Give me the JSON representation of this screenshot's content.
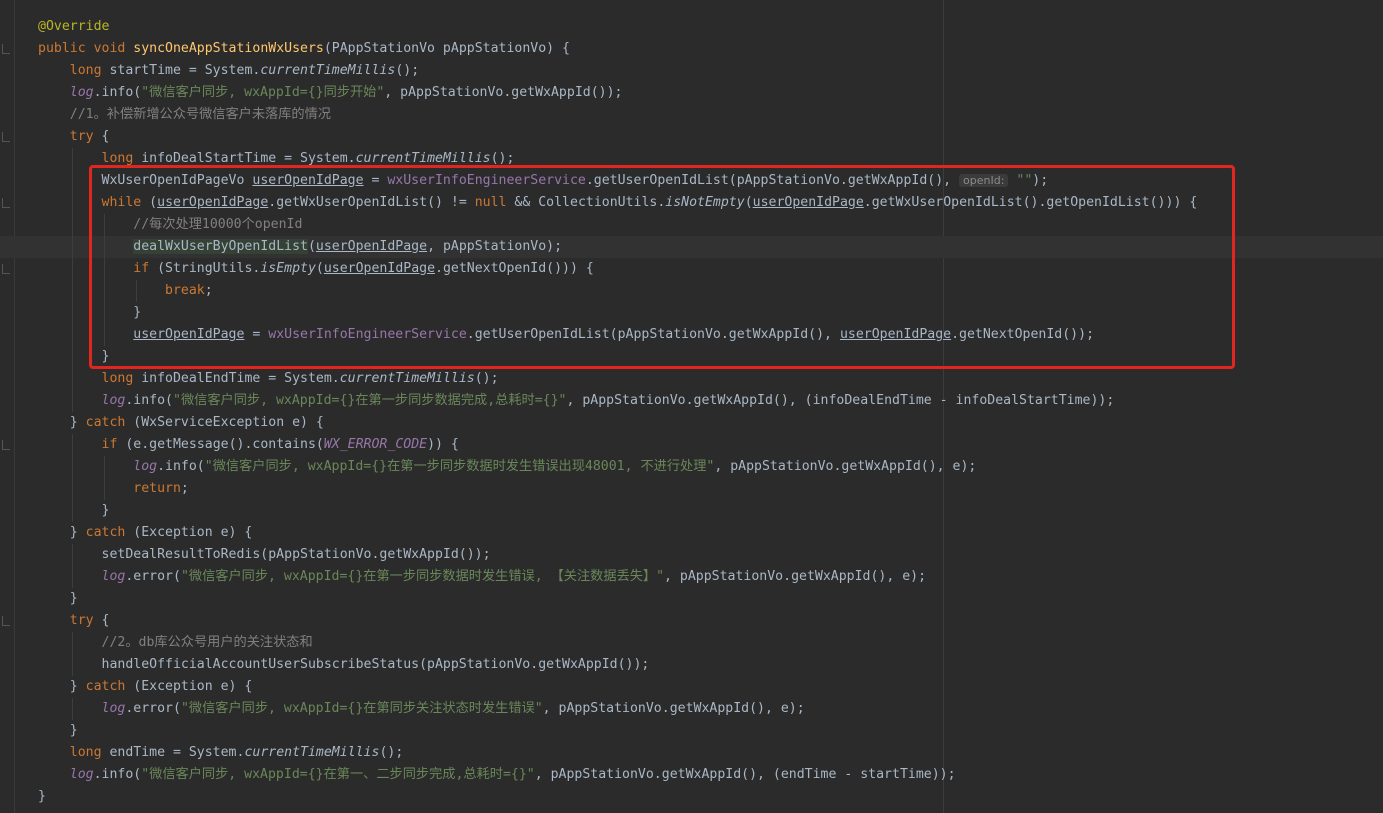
{
  "editor": {
    "lines": [
      [
        [
          "ann",
          "@Override"
        ]
      ],
      [
        [
          "kw",
          "public void "
        ],
        [
          "fn",
          "syncOneAppStationWxUsers"
        ],
        [
          "",
          "(PAppStationVo pAppStationVo) {"
        ]
      ],
      [
        [
          "",
          "    "
        ],
        [
          "kw",
          "long "
        ],
        [
          "",
          "startTime = System."
        ],
        [
          "it",
          "currentTimeMillis"
        ],
        [
          "",
          "();"
        ]
      ],
      [
        [
          "",
          "    "
        ],
        [
          "fieldi",
          "log"
        ],
        [
          "",
          ".info("
        ],
        [
          "str",
          "\"微信客户同步, wxAppId={}同步开始\""
        ],
        [
          "",
          ", pAppStationVo.getWxAppId());"
        ]
      ],
      [
        [
          "",
          "    "
        ],
        [
          "cmt",
          "//1。补偿新增公众号微信客户未落库的情况"
        ]
      ],
      [
        [
          "",
          "    "
        ],
        [
          "kw",
          "try "
        ],
        [
          "",
          "{"
        ]
      ],
      [
        [
          "",
          "        "
        ],
        [
          "kw",
          "long "
        ],
        [
          "",
          "infoDealStartTime = System."
        ],
        [
          "it",
          "currentTimeMillis"
        ],
        [
          "",
          "();"
        ]
      ],
      [
        [
          "",
          "        WxUserOpenIdPageVo "
        ],
        [
          "ul",
          "userOpenIdPage"
        ],
        [
          "",
          " = "
        ],
        [
          "field",
          "wxUserInfoEngineerService"
        ],
        [
          "",
          ".getUserOpenIdList(pAppStationVo.getWxAppId(), "
        ],
        [
          "hint",
          "openId:"
        ],
        [
          "",
          " "
        ],
        [
          "str",
          "\"\""
        ],
        [
          "",
          ");"
        ]
      ],
      [
        [
          "",
          "        "
        ],
        [
          "kw",
          "while "
        ],
        [
          "",
          "("
        ],
        [
          "ul",
          "userOpenIdPage"
        ],
        [
          "",
          ".getWxUserOpenIdList() != "
        ],
        [
          "kw",
          "null "
        ],
        [
          "",
          "&& CollectionUtils."
        ],
        [
          "it",
          "isNotEmpty"
        ],
        [
          "",
          "("
        ],
        [
          "ul",
          "userOpenIdPage"
        ],
        [
          "",
          ".getWxUserOpenIdList().getOpenIdList())) {"
        ]
      ],
      [
        [
          "",
          "            "
        ],
        [
          "cmt",
          "//每次处理10000个openId"
        ]
      ],
      [
        [
          "",
          "            "
        ],
        [
          "hl",
          "dealWxUserByOpenIdList"
        ],
        [
          "",
          "("
        ],
        [
          "ul",
          "userOpenIdPage"
        ],
        [
          "",
          ", pAppStationVo);"
        ]
      ],
      [
        [
          "",
          "            "
        ],
        [
          "kw",
          "if "
        ],
        [
          "",
          "(StringUtils."
        ],
        [
          "it",
          "isEmpty"
        ],
        [
          "",
          "("
        ],
        [
          "ul",
          "userOpenIdPage"
        ],
        [
          "",
          ".getNextOpenId())) {"
        ]
      ],
      [
        [
          "",
          "                "
        ],
        [
          "kw",
          "break"
        ],
        [
          "",
          ";"
        ]
      ],
      [
        [
          "",
          "            }"
        ]
      ],
      [
        [
          "",
          "            "
        ],
        [
          "ul",
          "userOpenIdPage"
        ],
        [
          "",
          " = "
        ],
        [
          "field",
          "wxUserInfoEngineerService"
        ],
        [
          "",
          ".getUserOpenIdList(pAppStationVo.getWxAppId(), "
        ],
        [
          "ul",
          "userOpenIdPage"
        ],
        [
          "",
          ".getNextOpenId());"
        ]
      ],
      [
        [
          "",
          "        }"
        ]
      ],
      [
        [
          "",
          "        "
        ],
        [
          "kw",
          "long "
        ],
        [
          "",
          "infoDealEndTime = System."
        ],
        [
          "it",
          "currentTimeMillis"
        ],
        [
          "",
          "();"
        ]
      ],
      [
        [
          "",
          "        "
        ],
        [
          "fieldi",
          "log"
        ],
        [
          "",
          ".info("
        ],
        [
          "str",
          "\"微信客户同步, wxAppId={}在第一步同步数据完成,总耗时={}\""
        ],
        [
          "",
          ", pAppStationVo.getWxAppId(), (infoDealEndTime - infoDealStartTime));"
        ]
      ],
      [
        [
          "",
          "    } "
        ],
        [
          "kw",
          "catch "
        ],
        [
          "",
          "(WxServiceException e) {"
        ]
      ],
      [
        [
          "",
          "        "
        ],
        [
          "kw",
          "if "
        ],
        [
          "",
          "(e.getMessage().contains("
        ],
        [
          "fieldi",
          "WX_ERROR_CODE"
        ],
        [
          "",
          ")) {"
        ]
      ],
      [
        [
          "",
          "            "
        ],
        [
          "fieldi",
          "log"
        ],
        [
          "",
          ".info("
        ],
        [
          "str",
          "\"微信客户同步, wxAppId={}在第一步同步数据时发生错误出现48001, 不进行处理\""
        ],
        [
          "",
          ", pAppStationVo.getWxAppId(), e);"
        ]
      ],
      [
        [
          "",
          "            "
        ],
        [
          "kw",
          "return"
        ],
        [
          "",
          ";"
        ]
      ],
      [
        [
          "",
          "        }"
        ]
      ],
      [
        [
          "",
          "    } "
        ],
        [
          "kw",
          "catch "
        ],
        [
          "",
          "(Exception e) {"
        ]
      ],
      [
        [
          "",
          "        setDealResultToRedis(pAppStationVo.getWxAppId());"
        ]
      ],
      [
        [
          "",
          "        "
        ],
        [
          "fieldi",
          "log"
        ],
        [
          "",
          ".error("
        ],
        [
          "str",
          "\"微信客户同步, wxAppId={}在第一步同步数据时发生错误, 【关注数据丢失】\""
        ],
        [
          "",
          ", pAppStationVo.getWxAppId(), e);"
        ]
      ],
      [
        [
          "",
          "    }"
        ]
      ],
      [
        [
          "",
          "    "
        ],
        [
          "kw",
          "try "
        ],
        [
          "",
          "{"
        ]
      ],
      [
        [
          "",
          "        "
        ],
        [
          "cmt",
          "//2。db库公众号用户的关注状态和"
        ]
      ],
      [
        [
          "",
          "        handleOfficialAccountUserSubscribeStatus(pAppStationVo.getWxAppId());"
        ]
      ],
      [
        [
          "",
          "    } "
        ],
        [
          "kw",
          "catch "
        ],
        [
          "",
          "(Exception e) {"
        ]
      ],
      [
        [
          "",
          "        "
        ],
        [
          "fieldi",
          "log"
        ],
        [
          "",
          ".error("
        ],
        [
          "str",
          "\"微信客户同步, wxAppId={}在第同步关注状态时发生错误\""
        ],
        [
          "",
          ", pAppStationVo.getWxAppId(), e);"
        ]
      ],
      [
        [
          "",
          "    }"
        ]
      ],
      [
        [
          "",
          "    "
        ],
        [
          "kw",
          "long "
        ],
        [
          "",
          "endTime = System."
        ],
        [
          "it",
          "currentTimeMillis"
        ],
        [
          "",
          "();"
        ]
      ],
      [
        [
          "",
          "    "
        ],
        [
          "fieldi",
          "log"
        ],
        [
          "",
          ".info("
        ],
        [
          "str",
          "\"微信客户同步, wxAppId={}在第一、二步同步完成,总耗时={}\""
        ],
        [
          "",
          ", pAppStationVo.getWxAppId(), (endTime - startTime));"
        ]
      ],
      [
        [
          "",
          "}"
        ]
      ]
    ]
  }
}
